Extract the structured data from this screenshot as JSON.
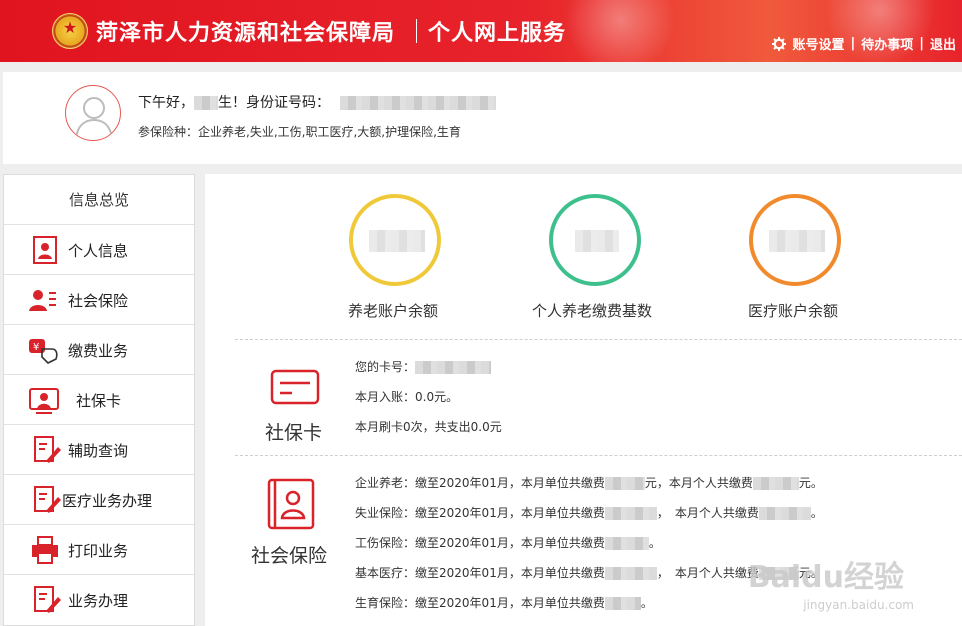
{
  "header": {
    "title": "菏泽市人力资源和社会保障局",
    "subtitle": "个人网上服务",
    "links": [
      "账号设置",
      "待办事项",
      "退出"
    ],
    "separator": "|"
  },
  "user": {
    "greeting_prefix": "下午好，",
    "greeting_suffix": "生！身份证号码：",
    "insurance_label": "参保险种：",
    "insurance_types": "企业养老,失业,工伤,职工医疗,大额,护理保险,生育"
  },
  "sidebar": {
    "heading": "信息总览",
    "items": [
      {
        "label": "个人信息",
        "icon": "person-card-icon"
      },
      {
        "label": "社会保险",
        "icon": "people-list-icon"
      },
      {
        "label": "缴费业务",
        "icon": "yuan-hand-icon"
      },
      {
        "label": "社保卡",
        "icon": "id-card-icon"
      },
      {
        "label": "辅助查询",
        "icon": "edit-doc-icon"
      },
      {
        "label": "医疗业务办理",
        "icon": "edit-doc-icon"
      },
      {
        "label": "打印业务",
        "icon": "printer-icon"
      },
      {
        "label": "业务办理",
        "icon": "edit-doc-icon"
      }
    ]
  },
  "overview": {
    "rings": [
      {
        "label": "养老账户余额",
        "color": "#f0c93a"
      },
      {
        "label": "个人养老缴费基数",
        "color": "#3ec08d"
      },
      {
        "label": "医疗账户余额",
        "color": "#f08a2c"
      }
    ]
  },
  "card_section": {
    "title": "社保卡",
    "card_no_label": "您的卡号：",
    "month_income": "本月入账：0.0元。",
    "month_swipe": "本月刷卡0次，共支出0.0元"
  },
  "insurance_section": {
    "title": "社会保险",
    "lines": [
      {
        "name": "企业养老：",
        "paid_to": "缴至2020年01月，",
        "unit": "本月单位共缴费",
        "unit_tail": "元，",
        "person": "本月个人共缴费",
        "person_tail": "元。"
      },
      {
        "name": "失业保险：",
        "paid_to": "缴至2020年01月，",
        "unit": "本月单位共缴费",
        "unit_tail": "，",
        "person": "本月个人共缴费",
        "person_tail": "。"
      },
      {
        "name": "工伤保险：",
        "paid_to": "缴至2020年01月，",
        "unit": "本月单位共缴费",
        "unit_tail": "。",
        "person": "",
        "person_tail": ""
      },
      {
        "name": "基本医疗：",
        "paid_to": "缴至2020年01月，",
        "unit": "本月单位共缴费",
        "unit_tail": "，",
        "person": "本月个人共缴费",
        "person_tail": "元。"
      },
      {
        "name": "生育保险：",
        "paid_to": "缴至2020年01月，",
        "unit": "本月单位共缴费",
        "unit_tail": "。",
        "person": "",
        "person_tail": ""
      }
    ]
  },
  "watermark": {
    "brand": "Baidu经验",
    "url": "jingyan.baidu.com"
  },
  "colors": {
    "brand_red": "#e0141f",
    "icon_red": "#d9232b"
  }
}
